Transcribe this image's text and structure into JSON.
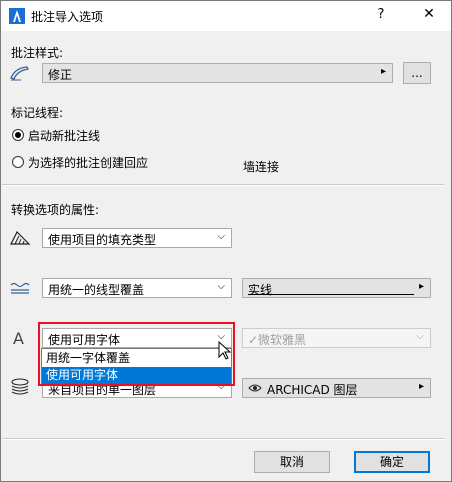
{
  "window": {
    "title": "批注导入选项",
    "help": "?",
    "close": "✕"
  },
  "style_section": {
    "label": "批注样式:",
    "value": "修正",
    "arrow": "▸",
    "more": "..."
  },
  "leader": {
    "label": "标记线程:",
    "option1": "启动新批注线",
    "option2": "为选择的批注创建回应",
    "wall_join": "墙连接"
  },
  "convert": {
    "label": "转换选项的属性:",
    "fill": {
      "value": "使用项目的填充类型",
      "arrow": "⌵"
    },
    "line": {
      "value": "用统一的线型覆盖",
      "arrow": "⌵",
      "linetype": "实线",
      "lt_arrow": "▸"
    },
    "font": {
      "value": "使用可用字体",
      "arrow": "⌵",
      "font_name": "✓微软雅黑",
      "font_arrow": "⌵",
      "letter": "A",
      "options": [
        "用统一字体覆盖",
        "使用可用字体"
      ]
    },
    "layer": {
      "value": "来自项目的单一图层",
      "arrow": "⌵",
      "layer_name": "ARCHICAD 图层",
      "layer_arrow": "▸"
    }
  },
  "footer": {
    "cancel": "取消",
    "ok": "确定"
  }
}
